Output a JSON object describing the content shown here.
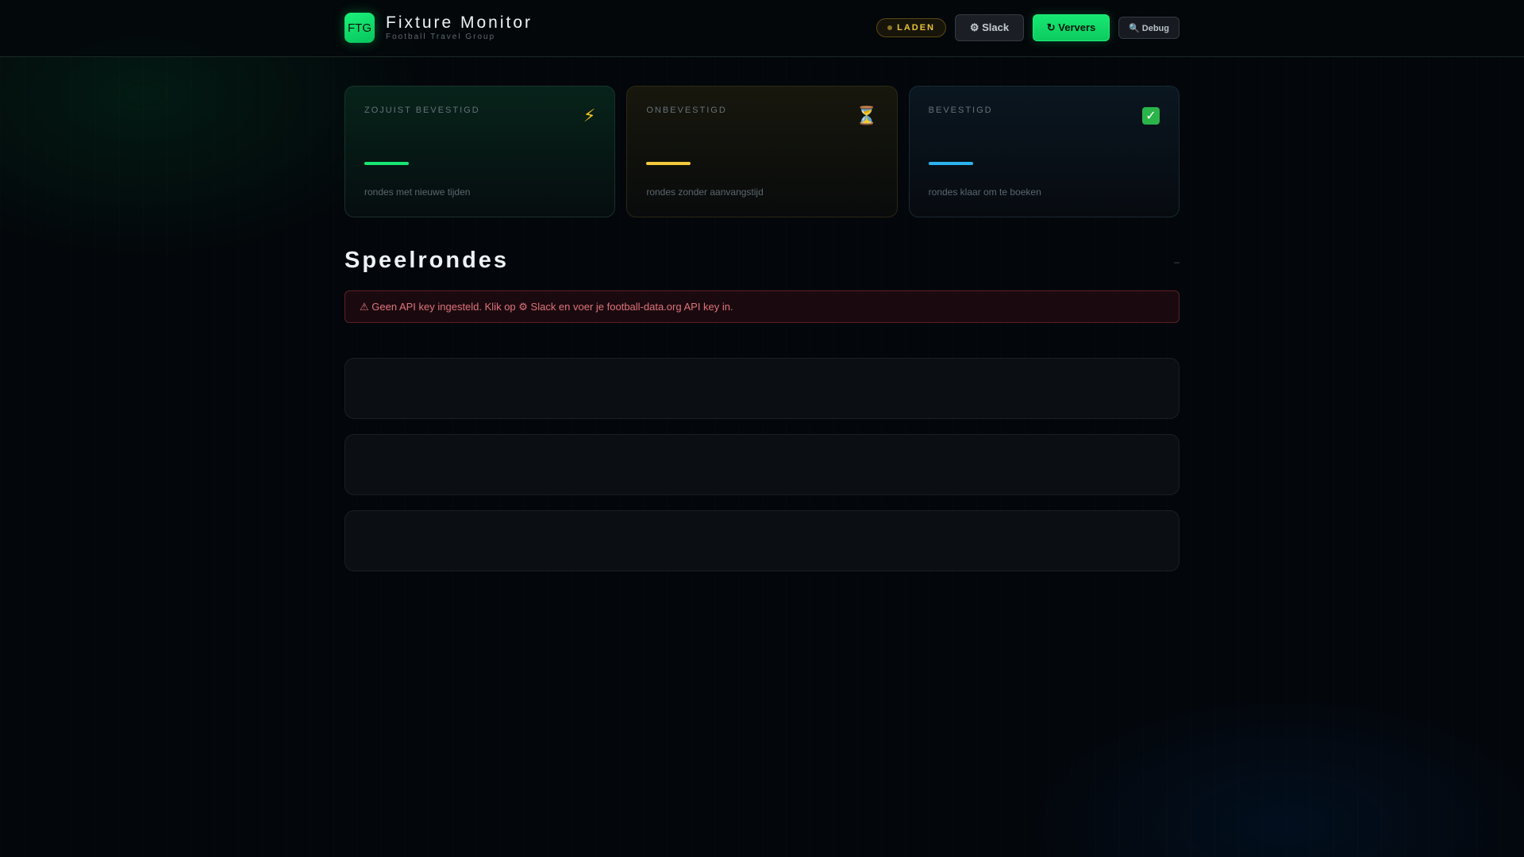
{
  "header": {
    "logo_text": "FTG",
    "title": "Fixture Monitor",
    "subtitle": "Football Travel Group",
    "status_label": "LADEN",
    "slack_label": "⚙ Slack",
    "refresh_label": "↻ Ververs",
    "debug_label": "🔍 Debug"
  },
  "cards": [
    {
      "label": "ZOJUIST BEVESTIGD",
      "icon": "lightning-icon",
      "icon_glyph": "⚡",
      "description": "rondes met nieuwe tijden",
      "accent": "#17e673"
    },
    {
      "label": "ONBEVESTIGD",
      "icon": "hourglass-icon",
      "icon_glyph": "⏳",
      "description": "rondes zonder aanvangstijd",
      "accent": "#f3c93a"
    },
    {
      "label": "BEVESTIGD",
      "icon": "check-box-icon",
      "icon_glyph": "✓",
      "description": "rondes klaar om te boeken",
      "accent": "#2cb4f0"
    }
  ],
  "section": {
    "title": "Speelrondes",
    "meta": "–"
  },
  "alert": {
    "text": "⚠ Geen API key ingesteld. Klik op ⚙ Slack en voer je football-data.org API key in."
  },
  "colors": {
    "brand": "#16e873",
    "status": "#e8c33a",
    "danger": "#e0737a"
  }
}
